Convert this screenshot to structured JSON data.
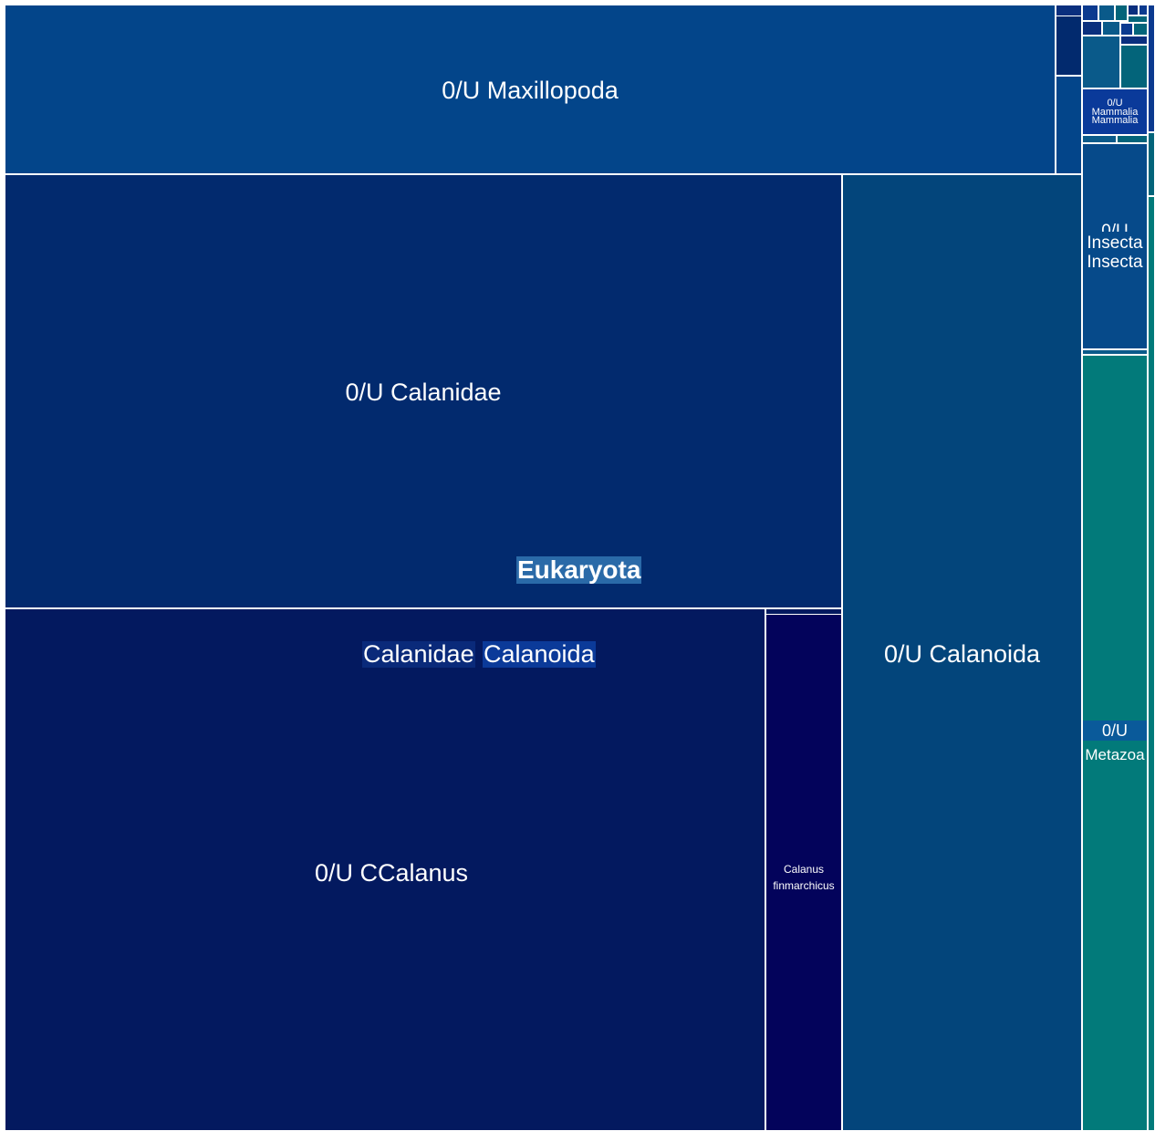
{
  "chart_data": {
    "type": "treemap",
    "root": "Eukaryota",
    "nodes": [
      {
        "name": "Calanidae",
        "label": "0/U Calanidae",
        "value": 43.5,
        "parent": "Calanoida"
      },
      {
        "name": "Calanus",
        "label": "0/U CCalanus",
        "value": 38.9,
        "parent": "Calanidae"
      },
      {
        "name": "Calanus finmarchicus",
        "label": "Calanus finmarchicus",
        "value": 3.9,
        "parent": "Calanus"
      },
      {
        "name": "Calanoida",
        "label": "0/U Calanoida",
        "value": 20.8,
        "parent": "Maxillopoda"
      },
      {
        "name": "Maxillopoda",
        "label": "0/U Maxillopoda",
        "value": 13.3,
        "parent": "Metazoa"
      },
      {
        "name": "Mammalia",
        "label": "0/U Mammalia Mammalia",
        "value": 0.3,
        "parent": "Metazoa"
      },
      {
        "name": "Insecta",
        "label": "0/U Insecta Insecta",
        "value": 1.3,
        "parent": "Metazoa"
      },
      {
        "name": "Metazoa",
        "label": "0/U Metazoa",
        "value": 4.8,
        "parent": "Eukaryota"
      }
    ],
    "overlay_labels": [
      "Eukaryota",
      "Calanidae",
      "Calanoida"
    ]
  },
  "labels": {
    "maxillopoda": "0/U Maxillopoda",
    "calanidae": "0/U Calanidae",
    "calanus": "0/U CCalanus",
    "finmarchicus": "Calanus finmarchicus",
    "calanoida": "0/U Calanoida",
    "mammalia_1": "0/U",
    "mammalia_2": "Mammalia",
    "mammalia_3": "Mammalia",
    "insecta_1": "0/U",
    "insecta_2": "Insecta",
    "insecta_3": "Insecta",
    "metazoa_1": "0/U",
    "metazoa_2": "Metazoa",
    "eukaryota": "Eukaryota",
    "hl_calanidae": "Calanidae",
    "hl_calanoida": "Calanoida"
  },
  "colors": {
    "maxillopoda": "#03458a",
    "calanidae": "#022a6e",
    "calanus": "#03195f",
    "finmarchicus": "#03035b",
    "calanoida": "#03457b",
    "mammalia": "#0a3a9a",
    "insecta": "#064a8a",
    "metazoa": "#027a7a",
    "small_a": "#0b3a8f",
    "small_b": "#0a5a8a",
    "small_c": "#03647a",
    "small_d": "#0a2f7e",
    "eukaryota_bg": "#2a6aa8",
    "calanidae_bg": "#0a2a7a",
    "calanoida_bg": "#0b3a99",
    "metazoa_hl_bg": "#0a5a9a"
  }
}
